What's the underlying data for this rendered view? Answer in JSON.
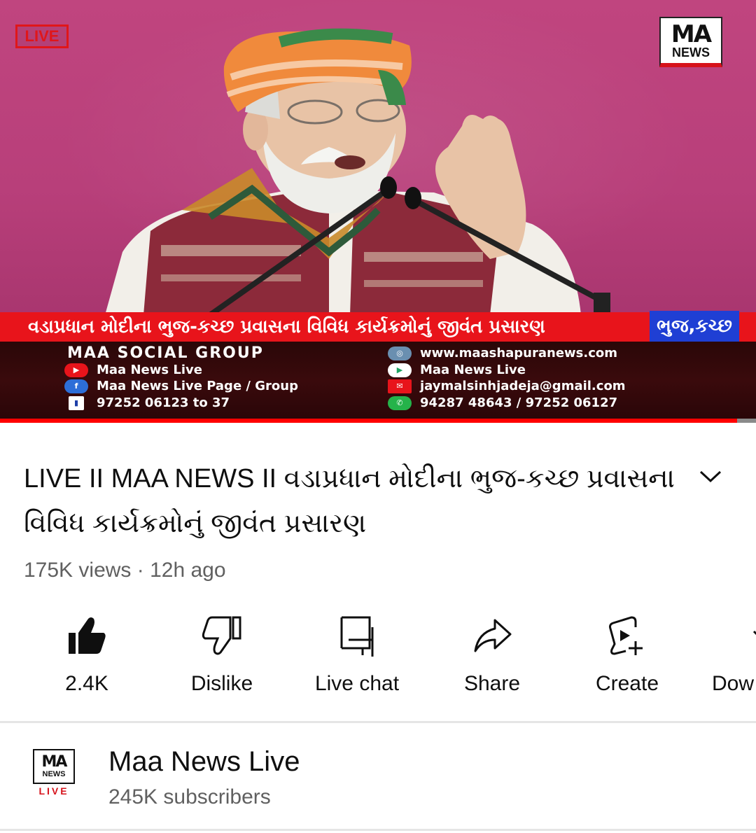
{
  "video": {
    "live_badge": "LIVE",
    "corner_logo": {
      "top": "MA",
      "bottom": "NEWS"
    },
    "ticker_text": "વડાપ્રધાન મોદીના ભુજ-કચ્છ પ્રવાસના વિવિધ કાર્યક્રમોનું જીવંત પ્રસારણ",
    "ticker_place": "ભુજ,કચ્છ",
    "info": {
      "group_title": "MAA SOCIAL GROUP",
      "youtube": "Maa News Live",
      "facebook": "Maa News Live Page / Group",
      "phone": "97252 06123 to 37",
      "website": "www.maashapuranews.com",
      "playstore": "Maa News Live",
      "email": "jaymalsinhjadeja@gmail.com",
      "whatsapp": "94287 48643 / 97252 06127"
    },
    "progress_fraction": 0.975,
    "colors": {
      "ticker": "#e8141b",
      "place": "#1f3fd4",
      "panel": "#2a0708",
      "progress": "#ff0000"
    }
  },
  "title": {
    "text": "LIVE II MAA NEWS II  વડાપ્રધાન મોદીના ભુજ-કચ્છ પ્રવાસના વિવિધ કાર્યક્રમોનું  જીવંત પ્રસારણ",
    "expand_icon": "chevron-down-icon"
  },
  "meta": {
    "views": "175K views",
    "separator": " · ",
    "time": "12h ago"
  },
  "actions": [
    {
      "label": "2.4K",
      "icon": "thumbs-up-filled-icon"
    },
    {
      "label": "Dislike",
      "icon": "thumbs-down-icon"
    },
    {
      "label": "Live chat",
      "icon": "live-chat-icon"
    },
    {
      "label": "Share",
      "icon": "share-icon"
    },
    {
      "label": "Create",
      "icon": "create-icon"
    },
    {
      "label": "Dow",
      "icon": "download-icon"
    }
  ],
  "channel": {
    "logo": {
      "top": "MA",
      "middle": "NEWS",
      "bottom": "LIVE"
    },
    "name": "Maa News Live",
    "subscribers": "245K subscribers"
  }
}
